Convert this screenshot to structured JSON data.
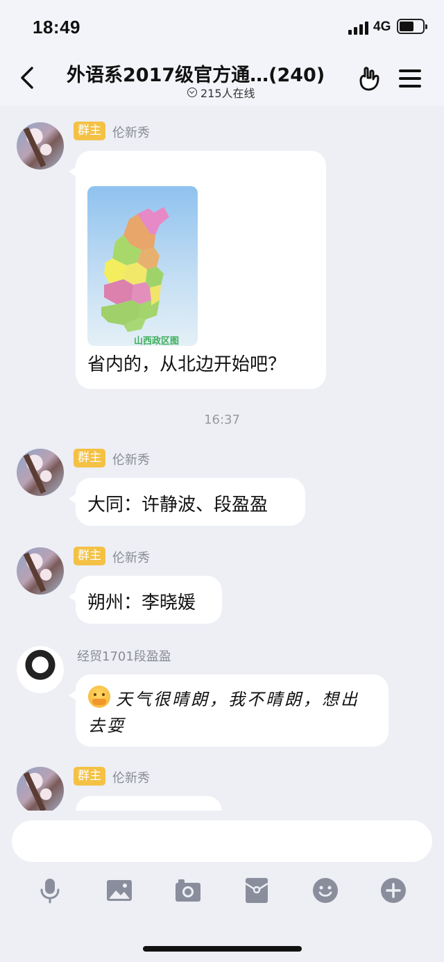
{
  "status_bar": {
    "time": "18:49",
    "network": "4G"
  },
  "header": {
    "title": "外语系2017级官方通…(240)",
    "online": "215人在线"
  },
  "messages": [
    {
      "role": "群主",
      "sender": "伦新秀",
      "map_caption": "山西政区图",
      "text": "省内的，从北边开始吧？"
    },
    {
      "timestamp": "16:37"
    },
    {
      "role": "群主",
      "sender": "伦新秀",
      "text": "大同：许静波、段盈盈"
    },
    {
      "role": "群主",
      "sender": "伦新秀",
      "text": "朔州：李晓媛"
    },
    {
      "sender": "经贸1701段盈盈",
      "text_line1": "天气很晴朗，我不晴朗，想出",
      "text_line2": "去耍"
    },
    {
      "role": "群主",
      "sender": "伦新秀"
    }
  ],
  "toolbar": {
    "icons": [
      "microphone-icon",
      "image-icon",
      "camera-icon",
      "red-packet-icon",
      "emoji-icon",
      "plus-icon"
    ]
  },
  "colors": {
    "background": "#edeff5",
    "owner_badge": "#f4c144",
    "icon_gray": "#8a8e9c"
  }
}
